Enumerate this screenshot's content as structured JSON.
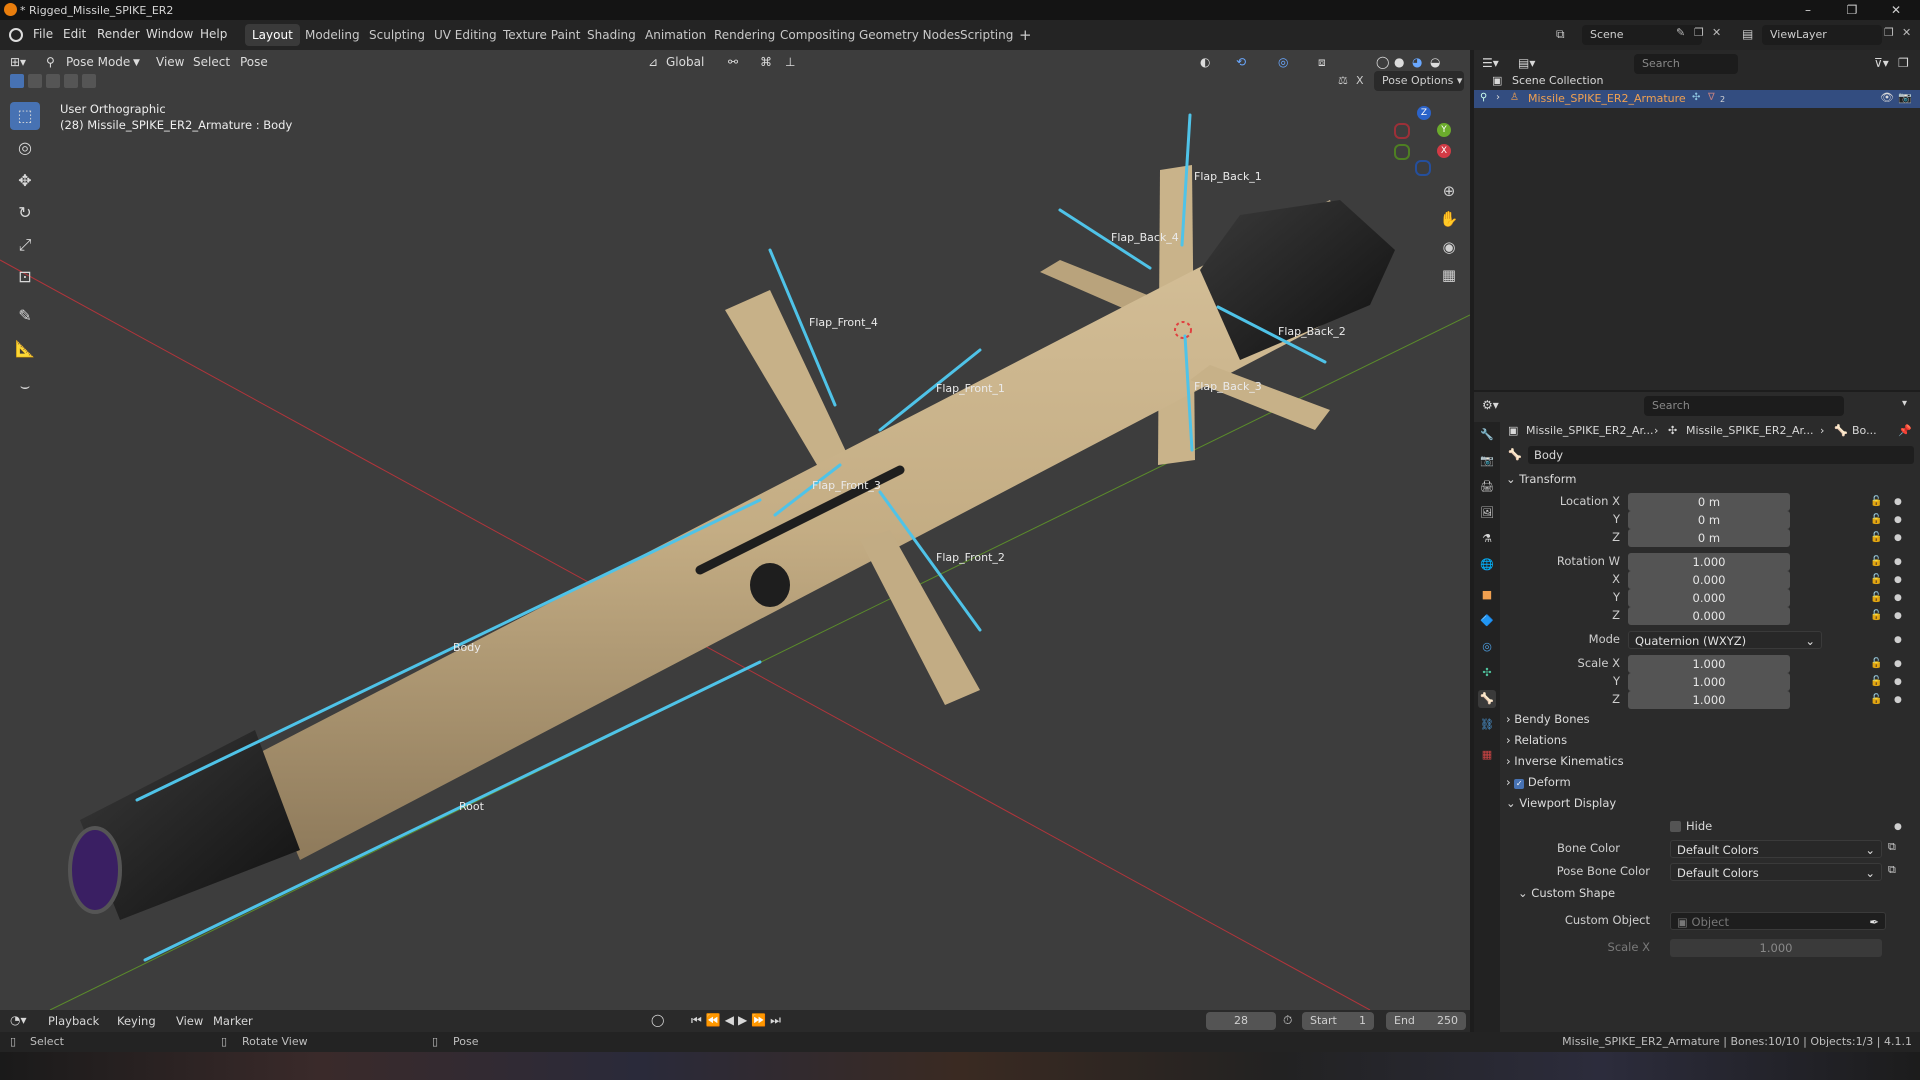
{
  "window": {
    "title": "* Rigged_Missile_SPIKE_ER2",
    "minimize": "–",
    "restore": "❐",
    "close": "✕"
  },
  "menus": [
    "File",
    "Edit",
    "Render",
    "Window",
    "Help"
  ],
  "workspaces": [
    "Layout",
    "Modeling",
    "Sculpting",
    "UV Editing",
    "Texture Paint",
    "Shading",
    "Animation",
    "Rendering",
    "Compositing",
    "Geometry Nodes",
    "Scripting"
  ],
  "workspace_add": "+",
  "scene": {
    "label": "Scene",
    "view_layer": "ViewLayer"
  },
  "viewport_header": {
    "mode": "Pose Mode",
    "menus": [
      "View",
      "Select",
      "Pose"
    ],
    "orientation": "Global",
    "pose_options": "Pose Options",
    "x_mirror": "X"
  },
  "viewport": {
    "view_name": "User Orthographic",
    "object_info": "(28) Missile_SPIKE_ER2_Armature : Body",
    "bones": [
      "Flap_Back_1",
      "Flap_Back_4",
      "Flap_Front_4",
      "Flap_Back_2",
      "Flap_Front_1",
      "Flap_Back_3",
      "Flap_Front_3",
      "Flap_Front_2",
      "Body",
      "Root"
    ],
    "gizmo_axes": [
      "Z",
      "Y",
      "X"
    ]
  },
  "outliner": {
    "search_placeholder": "Search",
    "collection": "Scene Collection",
    "item": "Missile_SPIKE_ER2_Armature",
    "item_badge": "2"
  },
  "properties": {
    "search_placeholder": "Search",
    "breadcrumb": [
      "Missile_SPIKE_ER2_Ar...",
      "Missile_SPIKE_ER2_Ar...",
      "Bo..."
    ],
    "bone_name": "Body",
    "transform_header": "Transform",
    "location": {
      "label_x": "Location X",
      "label_y": "Y",
      "label_z": "Z",
      "x": "0 m",
      "y": "0 m",
      "z": "0 m"
    },
    "rotation": {
      "label_w": "Rotation W",
      "label_x": "X",
      "label_y": "Y",
      "label_z": "Z",
      "w": "1.000",
      "x": "0.000",
      "y": "0.000",
      "z": "0.000"
    },
    "mode_label": "Mode",
    "mode_value": "Quaternion (WXYZ)",
    "scale": {
      "label_x": "Scale X",
      "label_y": "Y",
      "label_z": "Z",
      "x": "1.000",
      "y": "1.000",
      "z": "1.000"
    },
    "sections": [
      "Bendy Bones",
      "Relations",
      "Inverse Kinematics",
      "Deform",
      "Viewport Display"
    ],
    "hide_label": "Hide",
    "bone_color_label": "Bone Color",
    "bone_color_value": "Default Colors",
    "pose_bone_color_label": "Pose Bone Color",
    "pose_bone_color_value": "Default Colors",
    "custom_shape_header": "Custom Shape",
    "custom_object_label": "Custom Object",
    "custom_object_placeholder": "Object",
    "custom_scale_label": "Scale X",
    "custom_scale_value": "1.000"
  },
  "timeline": {
    "menus": [
      "Playback",
      "Keying",
      "View",
      "Marker"
    ],
    "current_frame": "28",
    "start_label": "Start",
    "start": "1",
    "end_label": "End",
    "end": "250"
  },
  "statusbar": {
    "select": "Select",
    "rotate": "Rotate View",
    "pose": "Pose",
    "info": "Missile_SPIKE_ER2_Armature | Bones:10/10 | Objects:1/3 | 4.1.1"
  },
  "colors": {
    "accent": "#4772b3",
    "bone": "#4fc3e8",
    "missile_body": "#c4ad84",
    "viewport_bg": "#3d3d3d"
  }
}
